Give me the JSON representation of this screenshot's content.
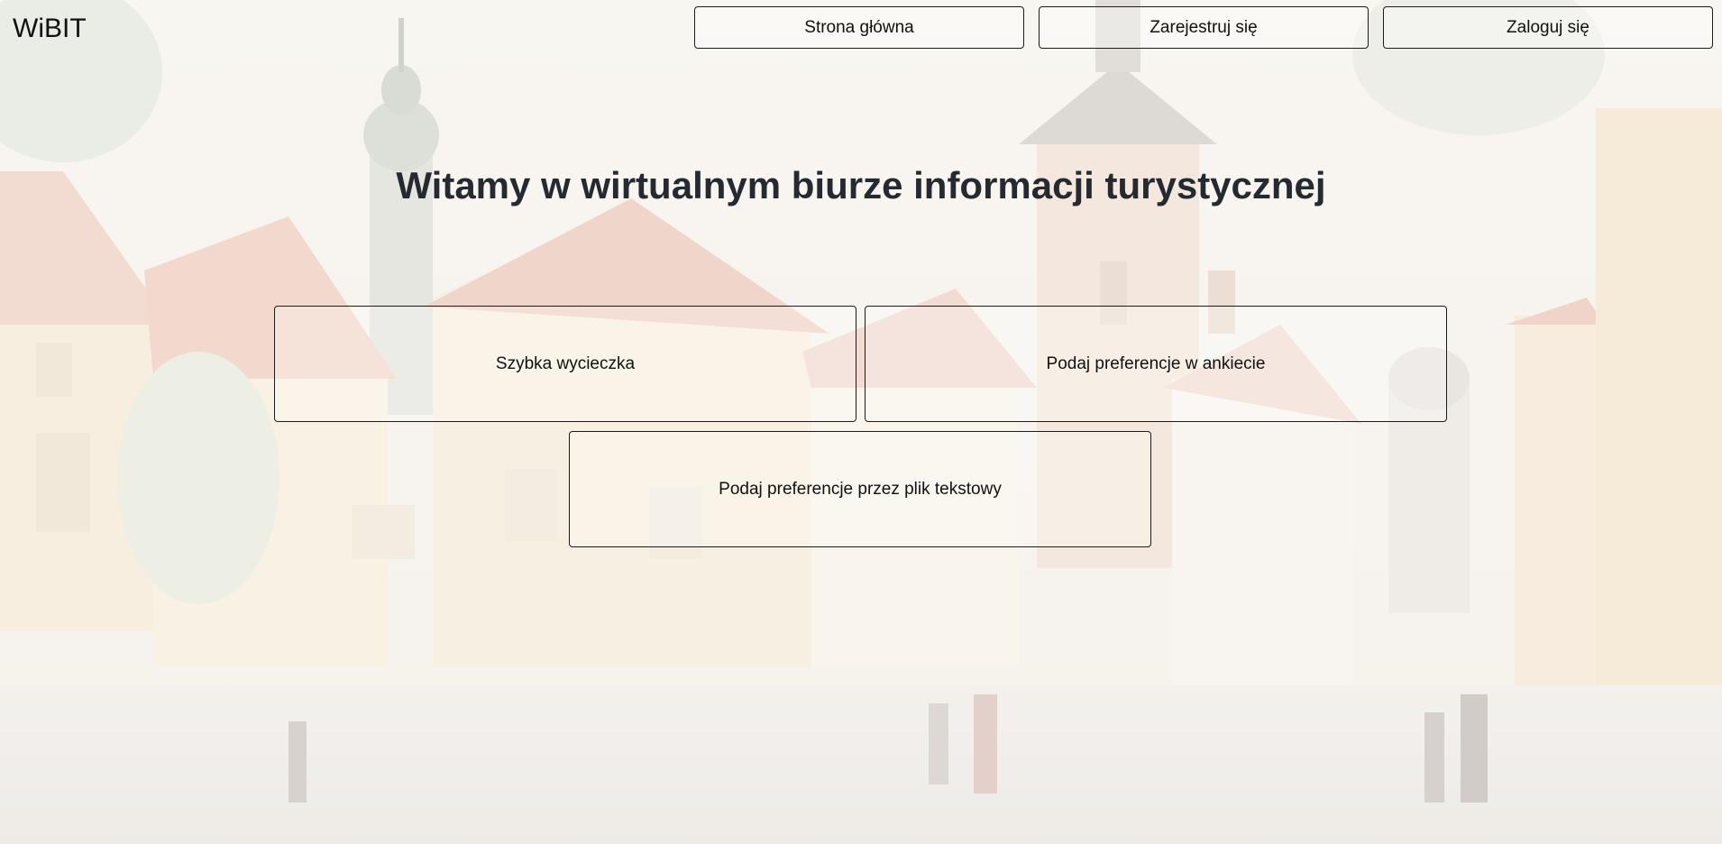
{
  "brand": {
    "name": "WiBIT"
  },
  "nav": {
    "home_label": "Strona główna",
    "register_label": "Zarejestruj się",
    "login_label": "Zaloguj się"
  },
  "main": {
    "title": "Witamy w wirtualnym biurze informacji turystycznej",
    "options": [
      {
        "label": "Szybka wycieczka"
      },
      {
        "label": "Podaj preferencje w ankiecie"
      },
      {
        "label": "Podaj preferencje przez plik tekstowy"
      }
    ]
  },
  "colors": {
    "text": "#212529",
    "border": "#1b1b1b",
    "background": "#f6f1ea"
  }
}
